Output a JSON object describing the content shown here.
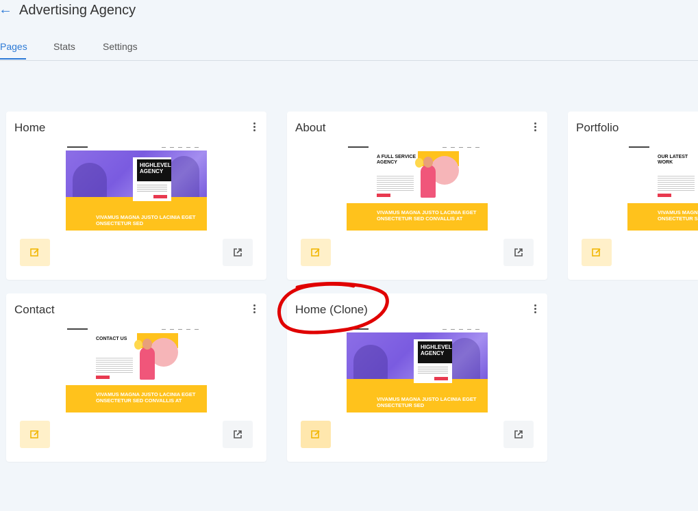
{
  "header": {
    "back_icon": "arrow-left-icon",
    "title": "Advertising Agency"
  },
  "tabs": [
    {
      "label": "Pages",
      "active": true
    },
    {
      "label": "Stats",
      "active": false
    },
    {
      "label": "Settings",
      "active": false
    }
  ],
  "colors": {
    "accent": "#2d7ad6",
    "edit_button_bg": "#fff0c9",
    "highlight_stroke": "#e00000",
    "thumb_yellow": "#ffc21c",
    "thumb_purple": "#7a5be0"
  },
  "pages": [
    {
      "title": "Home",
      "template": "hero",
      "thumb_heading": "HIGHLEVEL AGENCY",
      "thumb_banner": "VIVAMUS MAGNA JUSTO LACINIA EGET ONSECTETUR SED"
    },
    {
      "title": "About",
      "template": "illustration",
      "thumb_heading": "A FULL SERVICE AGENCY",
      "thumb_banner": "VIVAMUS MAGNA JUSTO LACINIA EGET ONSECTETUR SED CONVALLIS AT"
    },
    {
      "title": "Portfolio",
      "template": "illustration",
      "thumb_heading": "OUR LATEST WORK",
      "thumb_banner": "VIVAMUS MAGNA JUSTO LACINIA EGET ONSECTETUR SED CONVALLIS AT"
    },
    {
      "title": "Contact",
      "template": "illustration",
      "thumb_heading": "CONTACT US",
      "thumb_banner": "VIVAMUS MAGNA JUSTO LACINIA EGET ONSECTETUR SED CONVALLIS AT"
    },
    {
      "title": "Home (Clone)",
      "template": "hero",
      "thumb_heading": "HIGHLEVEL AGENCY",
      "thumb_banner": "VIVAMUS MAGNA JUSTO LACINIA EGET ONSECTETUR SED"
    }
  ],
  "icons": {
    "menu": "more-vertical-icon",
    "edit": "edit-icon",
    "open": "external-link-icon"
  },
  "annotation": {
    "shape": "hand-drawn-circle",
    "target": "Home (Clone)"
  }
}
